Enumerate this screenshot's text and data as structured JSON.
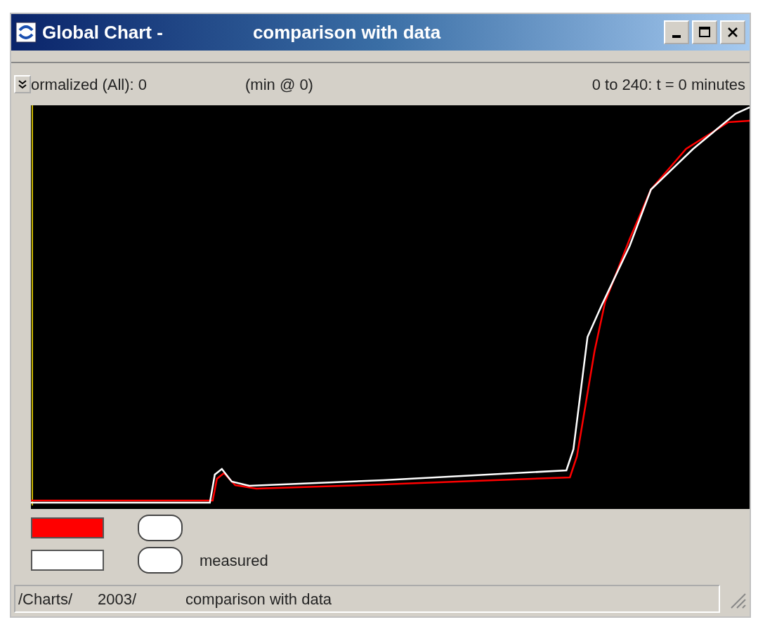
{
  "window": {
    "title": "Global Chart -",
    "subtitle": "comparison with data"
  },
  "header": {
    "left": "ormalized (All): 0",
    "middle": "(min @ 0)",
    "right": "0 to 240: t = 0 minutes"
  },
  "legend": [
    {
      "color": "#ff0000",
      "on": false
    },
    {
      "color": "#ffffff",
      "on": false,
      "label": "measured"
    }
  ],
  "status_bar": [
    "/Charts/",
    "2003/",
    "comparison with data"
  ]
}
